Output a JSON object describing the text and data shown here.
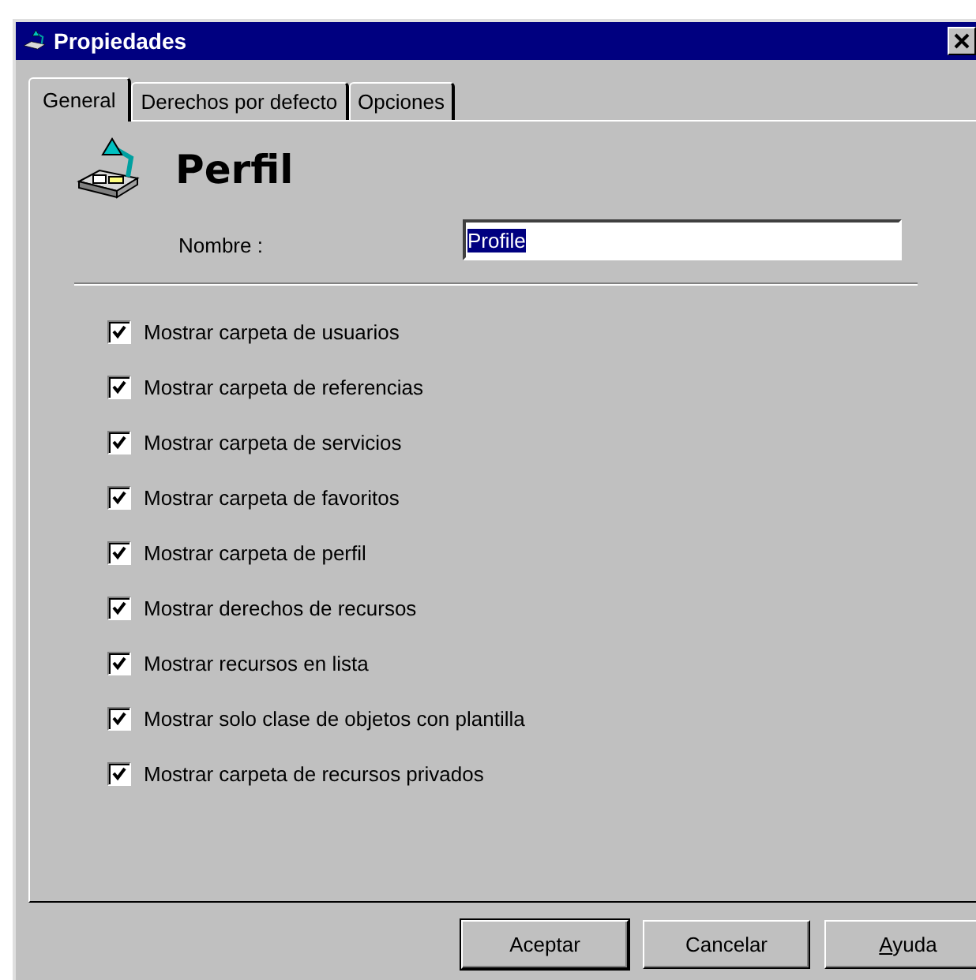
{
  "window": {
    "title": "Propiedades"
  },
  "tabs": [
    {
      "label": "General",
      "selected": true
    },
    {
      "label": "Derechos por defecto",
      "selected": false
    },
    {
      "label": "Opciones",
      "selected": false
    }
  ],
  "header": {
    "title": "Perfil"
  },
  "name_field": {
    "label": "Nombre :",
    "value": "Profile",
    "selected_text": true
  },
  "options": [
    {
      "label": "Mostrar carpeta de usuarios",
      "checked": true
    },
    {
      "label": "Mostrar carpeta de referencias",
      "checked": true
    },
    {
      "label": "Mostrar carpeta de servicios",
      "checked": true
    },
    {
      "label": "Mostrar carpeta de favoritos",
      "checked": true
    },
    {
      "label": "Mostrar carpeta de perfil",
      "checked": true
    },
    {
      "label": "Mostrar derechos de recursos",
      "checked": true
    },
    {
      "label": "Mostrar recursos en lista",
      "checked": true
    },
    {
      "label": "Mostrar solo clase de objetos con plantilla",
      "checked": true
    },
    {
      "label": "Mostrar carpeta de recursos privados",
      "checked": true
    }
  ],
  "buttons": [
    {
      "label": "Aceptar",
      "default": true,
      "underline_first": false
    },
    {
      "label": "Cancelar",
      "default": false,
      "underline_first": false
    },
    {
      "label": "Ayuda",
      "default": false,
      "underline_first": true
    }
  ]
}
